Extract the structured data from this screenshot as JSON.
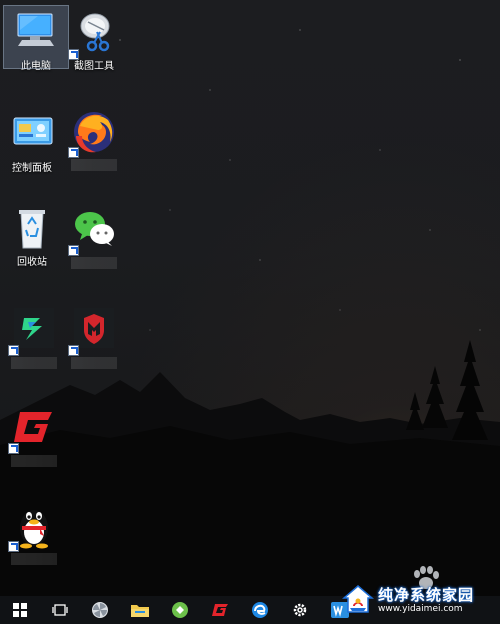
{
  "desktop": {
    "icons": {
      "this_pc": "此电脑",
      "snipping_tool": "截图工具",
      "control_panel": "控制面板",
      "recycle_bin": "回收站"
    }
  },
  "taskbar": {
    "items": [
      "start-icon",
      "task-view-icon",
      "app-icon",
      "file-explorer-icon",
      "green-app-icon",
      "red-g-app-icon",
      "edge-icon",
      "settings-icon",
      "wps-icon"
    ]
  },
  "watermark": {
    "title": "纯净系统家园",
    "url": "www.yidaimei.com"
  },
  "colors": {
    "taskbar": "#101215",
    "selection": "#7a8caa",
    "accent_blue": "#1e6fd9"
  }
}
